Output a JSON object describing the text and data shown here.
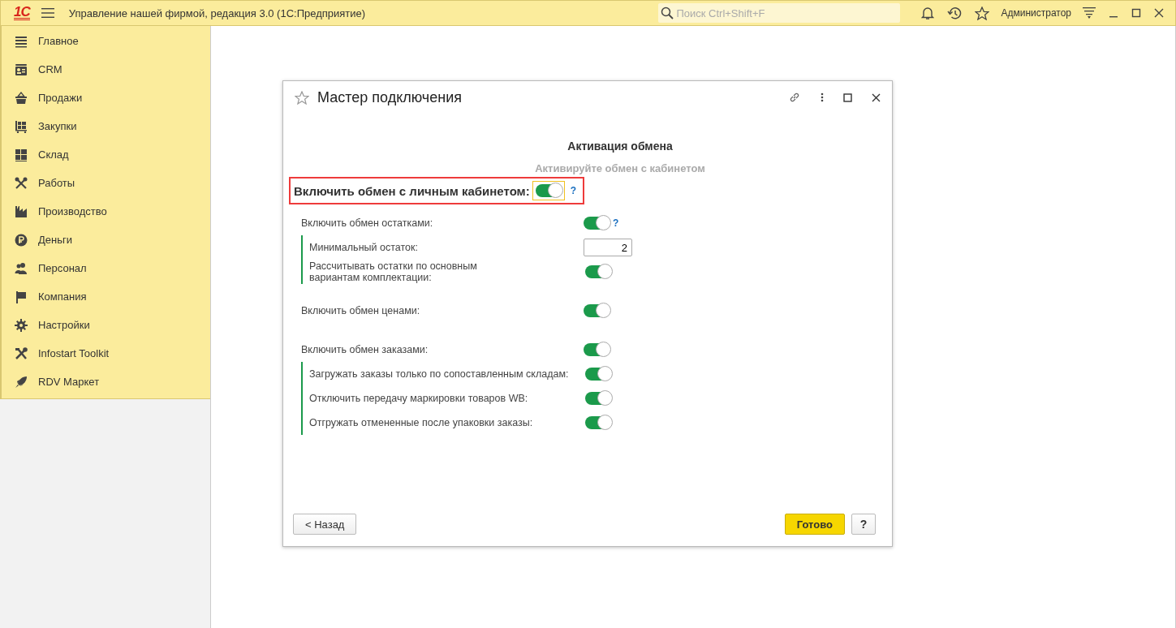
{
  "app": {
    "logo": "1С",
    "title": "Управление нашей фирмой, редакция 3.0  (1С:Предприятие)",
    "search_placeholder": "Поиск Ctrl+Shift+F",
    "user": "Администратор"
  },
  "sidebar": {
    "items": [
      {
        "label": "Главное",
        "selected": false
      },
      {
        "label": "CRM",
        "selected": false
      },
      {
        "label": "Продажи",
        "selected": false
      },
      {
        "label": "Закупки",
        "selected": false
      },
      {
        "label": "Склад",
        "selected": false
      },
      {
        "label": "Работы",
        "selected": false
      },
      {
        "label": "Производство",
        "selected": false
      },
      {
        "label": "Деньги",
        "selected": false
      },
      {
        "label": "Персонал",
        "selected": false
      },
      {
        "label": "Компания",
        "selected": false
      },
      {
        "label": "Настройки",
        "selected": false
      },
      {
        "label": "Infostart Toolkit",
        "selected": false
      },
      {
        "label": "RDV Маркет",
        "selected": false
      }
    ]
  },
  "dialog": {
    "title": "Мастер подключения",
    "heading": "Активация обмена",
    "subheading": "Активируйте обмен с кабинетом",
    "main_toggle": {
      "label": "Включить обмен с личным кабинетом:",
      "on": true,
      "help": "?"
    },
    "groups": [
      {
        "label": "Включить обмен остатками:",
        "on": true,
        "help": "?",
        "children": [
          {
            "kind": "number",
            "label": "Минимальный остаток:",
            "value": "2"
          },
          {
            "kind": "toggle",
            "label": "Рассчитывать остатки по основным\nвариантам комплектации:",
            "on": true
          }
        ]
      },
      {
        "label": "Включить обмен ценами:",
        "on": true
      },
      {
        "label": "Включить обмен заказами:",
        "on": true,
        "children": [
          {
            "kind": "toggle",
            "label": "Загружать заказы только по сопоставленным складам:",
            "on": true
          },
          {
            "kind": "toggle",
            "label": "Отключить передачу маркировки товаров WB:",
            "on": true
          },
          {
            "kind": "toggle",
            "label": "Отгружать отмененные после упаковки заказы:",
            "on": true
          }
        ]
      }
    ],
    "buttons": {
      "back": "< Назад",
      "done": "Готово",
      "help": "?"
    }
  }
}
